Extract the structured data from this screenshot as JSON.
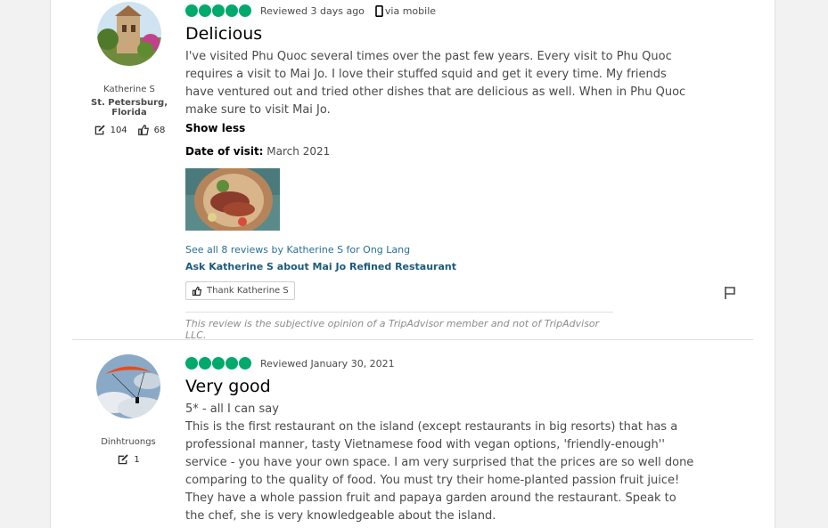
{
  "reviews": [
    {
      "user": {
        "name": "Katherine S",
        "location": "St. Petersburg, Florida",
        "contributions": "104",
        "helpful_votes": "68"
      },
      "rating": 5,
      "reviewed": "Reviewed 3 days ago",
      "via": "via mobile",
      "title": "Delicious",
      "text": "I've visited Phu Quoc several times over the past few years. Every visit to Phu Quoc requires a visit to Mai Jo. I love their stuffed squid and get it every time. My friends have ventured out and tried other dishes that are delicious as well. When in Phu Quoc make sure to visit Mai Jo.",
      "show_less": "Show less",
      "date_label": "Date of visit:",
      "date_value": " March 2021",
      "see_all": "See all 8 reviews by Katherine S for Ong Lang",
      "ask": "Ask Katherine S about Mai Jo Refined Restaurant",
      "thank": "Thank Katherine S",
      "disclaimer": "This review is the subjective opinion of a TripAdvisor member and not of TripAdvisor LLC."
    },
    {
      "user": {
        "name": "Dinhtruongs",
        "contributions": "1"
      },
      "rating": 5,
      "reviewed": "Reviewed January 30, 2021",
      "title": "Very good",
      "subtitle": "5* - all I can say",
      "text": "This is the first restaurant on the island (except restaurants in big resorts) that has a professional manner, tasty Vietnamese food with vegan options, 'friendly-enough'' service - you have your own space. I am very surprised that the prices are so well done comparing to the quality of food. You must try their home-planted passion fruit juice! They have a whole passion fruit and papaya garden around the restaurant. Speak to the chef, she is very knowledgeable about the island."
    }
  ],
  "colors": {
    "bubble": "#00aa6c",
    "link": "#2a6f93"
  },
  "icons": [
    "pencil-icon",
    "thumbs-up-icon",
    "mobile-icon",
    "flag-icon"
  ]
}
